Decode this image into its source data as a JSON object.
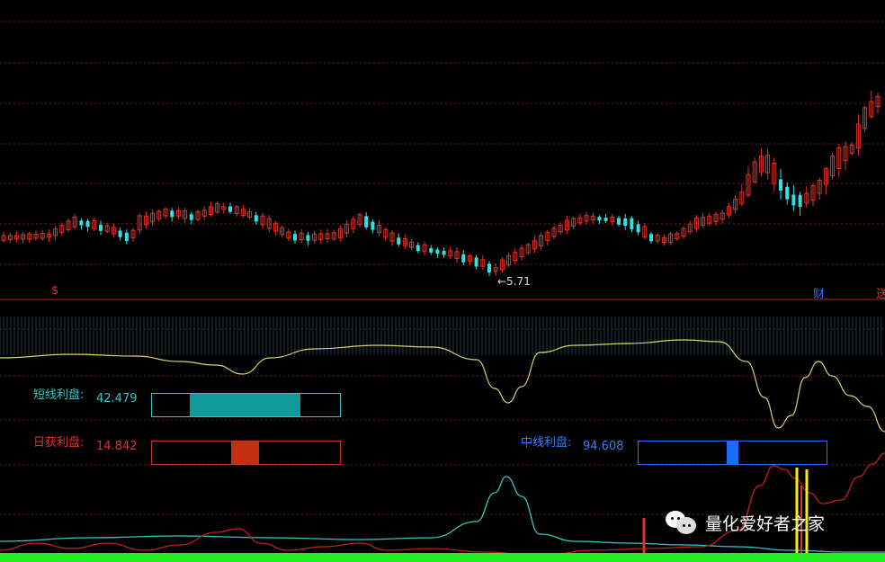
{
  "colors": {
    "background": "#000000",
    "up": "#e0322a",
    "down": "#33e0e0",
    "grid": "#7a1c1c",
    "divider": "#b52020",
    "yellow_line": "#d8d46a",
    "cyan_line": "#33c7c7",
    "red_line": "#c41e1e",
    "green_base": "#22ee22"
  },
  "price_chart": {
    "low_marker": "←5.71",
    "markers": [
      {
        "name": "left-marker",
        "text": "$",
        "color": "#e0322a"
      },
      {
        "name": "finance-marker",
        "text": "财",
        "color": "#2f6fff"
      },
      {
        "name": "right-edge-marker",
        "text": "送",
        "color": "#e0322a"
      }
    ]
  },
  "indicators": {
    "short": {
      "label": "短线利盘:",
      "value": "42.479",
      "color": "#33c7c7",
      "fill_color": "#119a99",
      "border_color": "#33c7c7",
      "fill_from": 0.2,
      "fill_to": 0.79
    },
    "daily": {
      "label": "日获利盘:",
      "value": "14.842",
      "color": "#e0322a",
      "fill_color": "#c4300f",
      "border_color": "#c43a2a",
      "fill_from": 0.42,
      "fill_to": 0.57
    },
    "mid": {
      "label": "中线利盘:",
      "value": "94.608",
      "color": "#2f7fff",
      "fill_color": "#1a6cff",
      "border_color": "#2f6fff",
      "fill_from": 0.47,
      "fill_to": 0.53
    }
  },
  "watermark": {
    "text": "量化爱好者之家",
    "icon": "wechat-icon"
  }
}
